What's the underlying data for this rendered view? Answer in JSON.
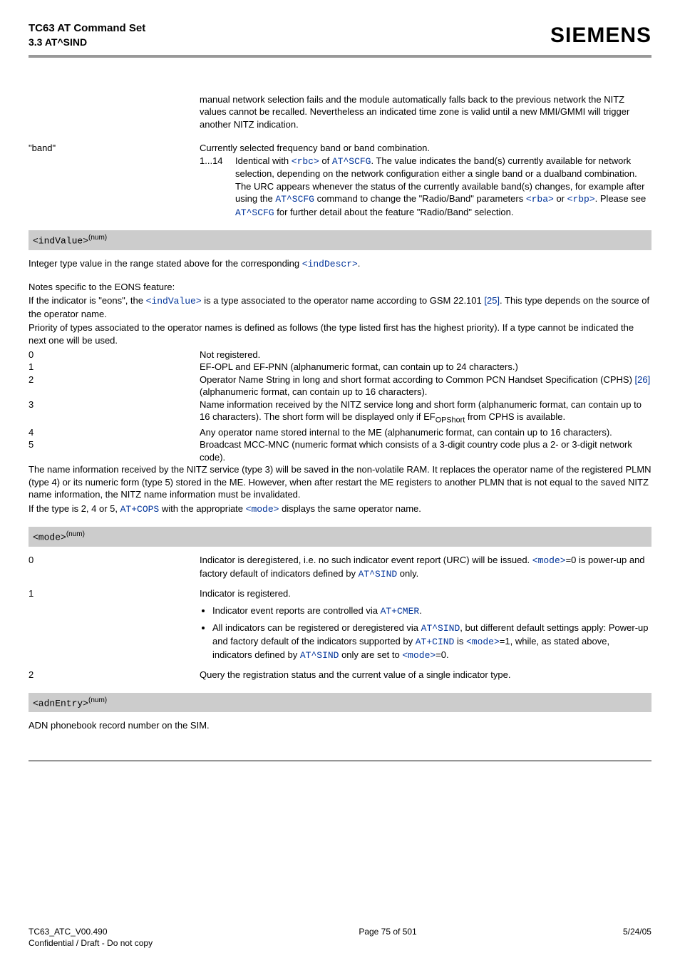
{
  "header": {
    "title": "TC63 AT Command Set",
    "subtitle": "3.3 AT^SIND",
    "logo": "SIEMENS"
  },
  "intro_para": "manual network selection fails and the module automatically falls back to the previous network the NITZ values cannot be recalled. Nevertheless an indicated time zone is valid until a new MMI/GMMI will trigger another NITZ indication.",
  "band": {
    "label": "\"band\"",
    "line1": "Currently selected frequency band or band combination.",
    "range": "1...14",
    "desc_a": "Identical with ",
    "rbc": "<rbc>",
    "desc_b": " of ",
    "atscfg": "AT^SCFG",
    "desc_c": ". The value indicates the band(s) currently available for network selection, depending on the network configuration either a single band or a dualband combination. The URC appears whenever the status of the currently available band(s) changes, for example after using the ",
    "desc_d": " command to change the \"Radio/Band\" parameters ",
    "rba": "<rba>",
    "or": " or ",
    "rbp": "<rbp>",
    "desc_e": ". Please see ",
    "desc_f": " for further detail about the feature \"Radio/Band\" selection."
  },
  "indValue": {
    "tag": "<indValue>",
    "sup": "(num)",
    "line1a": "Integer type value in the range stated above for the corresponding ",
    "indDescr": "<indDescr>",
    "line1b": ".",
    "notes_heading": "Notes specific to the EONS feature:",
    "notes_a": " If the indicator is \"eons\", the ",
    "indValueRef": "<indValue>",
    "notes_b": " is a type associated to the operator name according to GSM 22.101 ",
    "ref25": "[25]",
    "notes_c": ". This type depends on the source of the operator name.",
    "priority": "Priority of types associated to the operator names is defined as follows (the type listed first has the highest priority). If a type cannot be indicated the next one will be used.",
    "t0n": "0",
    "t0": "Not registered.",
    "t1n": "1",
    "t1": "EF-OPL and EF-PNN (alphanumeric format, can contain up to 24 characters.)",
    "t2n": "2",
    "t2a": "Operator Name String in long and short format according to Common PCN Handset Specification (CPHS) ",
    "ref26": "[26]",
    "t2b": " (alphanumeric format, can contain up to 16 characters).",
    "t3n": "3",
    "t3a": "Name information received by the NITZ service long and short form (alphanumeric format, can contain up to 16 characters). The short form will be displayed only if EF",
    "t3sub": "OPShort",
    "t3b": " from CPHS is available.",
    "t4n": "4",
    "t4": "Any operator name stored internal to the ME (alphanumeric format, can contain up to 16 characters).",
    "t5n": "5",
    "t5": "Broadcast MCC-MNC (numeric format which consists of a 3-digit country code plus a 2- or 3-digit network code).",
    "after": "The name information received by the NITZ service (type 3) will be saved in the non-volatile RAM. It replaces the operator name of the registered PLMN (type 4) or its numeric form (type 5) stored in the ME. However, when after restart the ME registers to another PLMN that is not equal to the saved NITZ name information, the NITZ name information must be invalidated.",
    "last_a": "If the type is 2, 4 or 5, ",
    "atcops": "AT+COPS",
    "last_b": " with the appropriate ",
    "modeRef": "<mode>",
    "last_c": " displays the same operator name."
  },
  "mode": {
    "tag": "<mode>",
    "sup": "(num)",
    "r0n": "0",
    "r0a": "Indicator is deregistered, i.e. no such indicator event report (URC) will be issued. ",
    "r0mode": "<mode>",
    "r0b": "=0 is power-up and factory default of indicators defined by ",
    "atsind": "AT^SIND",
    "r0c": " only.",
    "r1n": "1",
    "r1": "Indicator is registered.",
    "b1a": "Indicator event reports are controlled via ",
    "atcmer": "AT+CMER",
    "b1b": ".",
    "b2a": "All indicators can be registered or deregistered via ",
    "b2b": ", but different default settings apply: Power-up and factory default of the indicators supported by ",
    "atcind": "AT+CIND",
    "b2c": " is ",
    "b2mode1": "<mode>",
    "b2d": "=1, while, as stated above, indicators defined by ",
    "b2e": " only are set to ",
    "b2mode2": "<mode>",
    "b2f": "=0.",
    "r2n": "2",
    "r2": "Query the registration status and the current value of a single indicator type."
  },
  "adnEntry": {
    "tag": "<adnEntry>",
    "sup": "(num)",
    "desc": "ADN phonebook record number on the SIM."
  },
  "footer": {
    "left1": "TC63_ATC_V00.490",
    "left2": "Confidential / Draft - Do not copy",
    "center": "Page 75 of 501",
    "right": "5/24/05"
  }
}
